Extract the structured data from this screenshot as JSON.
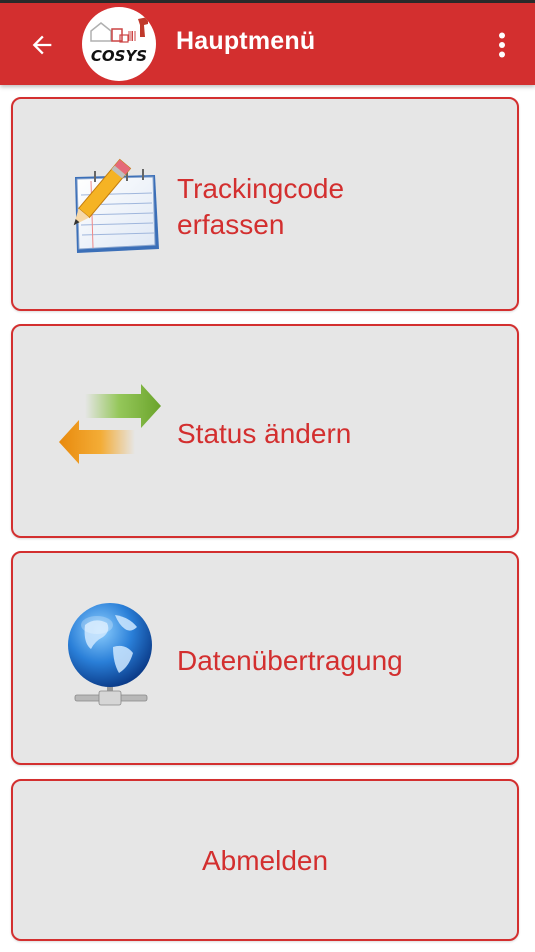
{
  "appbar": {
    "title": "Hauptmenü",
    "back_icon": "arrow-left-icon",
    "overflow_icon": "more-vert-icon",
    "logo_text": "COSYS",
    "background_color": "#d32f2f"
  },
  "menu": {
    "items": [
      {
        "label_line1": "Trackingcode",
        "label_line2": "erfassen",
        "icon": "notepad-pencil-icon"
      },
      {
        "label": "Status ändern",
        "icon": "swap-arrows-icon"
      },
      {
        "label": "Datenübertragung",
        "icon": "globe-network-icon"
      },
      {
        "label": "Abmelden"
      }
    ],
    "accent_color": "#d32f2f",
    "card_color": "#e6e6e6"
  }
}
